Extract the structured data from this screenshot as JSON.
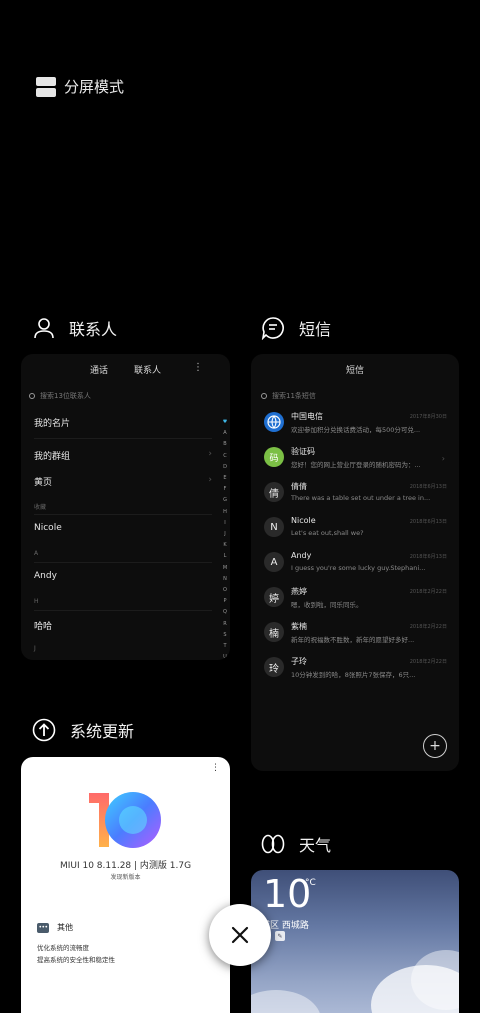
{
  "split_screen": {
    "icon": "split-screen-icon",
    "label": "分屏模式"
  },
  "contacts_app": {
    "icon": "person-icon",
    "name": "联系人",
    "tabs": [
      "通话",
      "联系人"
    ],
    "search_placeholder": "搜索13位联系人",
    "rows": [
      "我的名片",
      "我的群组",
      "黄页"
    ],
    "section_saved": "收藏",
    "contacts": [
      {
        "name": "Nicole",
        "section": "A"
      },
      {
        "name": "Andy",
        "section": "H"
      },
      {
        "name": "哈哈",
        "section": "J"
      }
    ],
    "alphabet": [
      "♥",
      "A",
      "B",
      "C",
      "D",
      "E",
      "F",
      "G",
      "H",
      "I",
      "J",
      "K",
      "L",
      "M",
      "N",
      "O",
      "P",
      "Q",
      "R",
      "S",
      "T",
      "U"
    ]
  },
  "sms_app": {
    "icon": "message-bubble-icon",
    "name": "短信",
    "title": "短信",
    "search_placeholder": "搜索11条短信",
    "messages": [
      {
        "avatar": "",
        "name": "中国电信",
        "time": "2017年8月30日",
        "preview": "欢迎参加积分兑换话费活动，每500分可兑...",
        "avatar_style": "globe",
        "chevron": false
      },
      {
        "avatar": "码",
        "name": "验证码",
        "time": "",
        "preview": "您好！您的网上营业厅登录的随机密码为：...",
        "avatar_style": "green",
        "chevron": true
      },
      {
        "avatar": "倩",
        "name": "倩倩",
        "time": "2018年6月13日",
        "preview": "There was a table set out under a tree in...",
        "avatar_style": "dark",
        "chevron": false
      },
      {
        "avatar": "N",
        "name": "Nicole",
        "time": "2018年6月13日",
        "preview": "Let's eat out,shall we?",
        "avatar_style": "dark",
        "chevron": false
      },
      {
        "avatar": "A",
        "name": "Andy",
        "time": "2018年6月13日",
        "preview": "I guess you're some lucky guy.Stephani...",
        "avatar_style": "dark",
        "chevron": false
      },
      {
        "avatar": "婷",
        "name": "燕婷",
        "time": "2018年2月22日",
        "preview": "嗯，收到啦，同乐同乐。",
        "avatar_style": "dark",
        "chevron": false
      },
      {
        "avatar": "楠",
        "name": "紫楠",
        "time": "2018年2月22日",
        "preview": "新年的祝福数不胜数，新年的愿望好多好...",
        "avatar_style": "dark",
        "chevron": false
      },
      {
        "avatar": "玲",
        "name": "子玲",
        "time": "2018年2月22日",
        "preview": "10分钟发到的哈，8张照片7张保存，6只...",
        "avatar_style": "dark",
        "chevron": false
      }
    ],
    "compose": "+"
  },
  "update_app": {
    "icon": "upload-arrow-icon",
    "name": "系统更新",
    "version": "MIUI 10 8.11.28 | 内测版 1.7G",
    "subtitle": "发现新版本",
    "section": "其他",
    "changes": [
      "优化系统的流畅度",
      "提高系统的安全性和稳定性"
    ],
    "logo_text": "10"
  },
  "weather_app": {
    "icon": "weather-infinity-icon",
    "name": "天气",
    "temperature": "10",
    "unit": "°C",
    "location": "城区  西城路"
  },
  "close_button": {
    "icon": "close-x-icon"
  },
  "colors": {
    "accent_blue": "#1f6fd1",
    "avatar_green": "#7bbf45",
    "heart": "#3fb6e5"
  }
}
